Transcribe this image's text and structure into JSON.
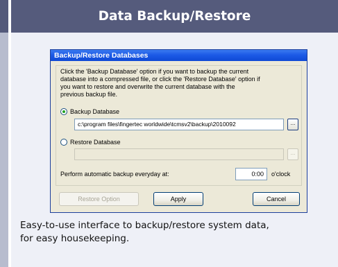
{
  "panel": {
    "title": "Data Backup/Restore",
    "caption_line1": "Easy-to-use interface to backup/restore system data,",
    "caption_line2": "for easy housekeeping."
  },
  "dialog": {
    "title": "Backup/Restore Databases",
    "description": [
      "Click the 'Backup Database' option if you want to backup the current",
      "database into a compressed file, or click the 'Restore Database' option if",
      "you want to restore and overwrite the current database with the",
      "previous backup file."
    ],
    "backup_option": {
      "label": "Backup Database",
      "selected": true
    },
    "backup_path": "c:\\program files\\fingertec worldwide\\tcmsv2\\backup\\2010092",
    "restore_option": {
      "label": "Restore Database",
      "selected": false
    },
    "restore_path": "",
    "browse_label": "...",
    "auto_backup_label": "Perform automatic backup everyday at:",
    "auto_backup_time": "0:00",
    "oclock_label": "o'clock",
    "buttons": {
      "restore_option": "Restore Option",
      "apply": "Apply",
      "cancel": "Cancel"
    }
  },
  "colors": {
    "header_bg": "#555b7c",
    "panel_bg": "#eef0f7",
    "titlebar_blue": "#1c5ae6",
    "dialog_bg": "#ece9d8",
    "radio_selected": "#21a121"
  }
}
